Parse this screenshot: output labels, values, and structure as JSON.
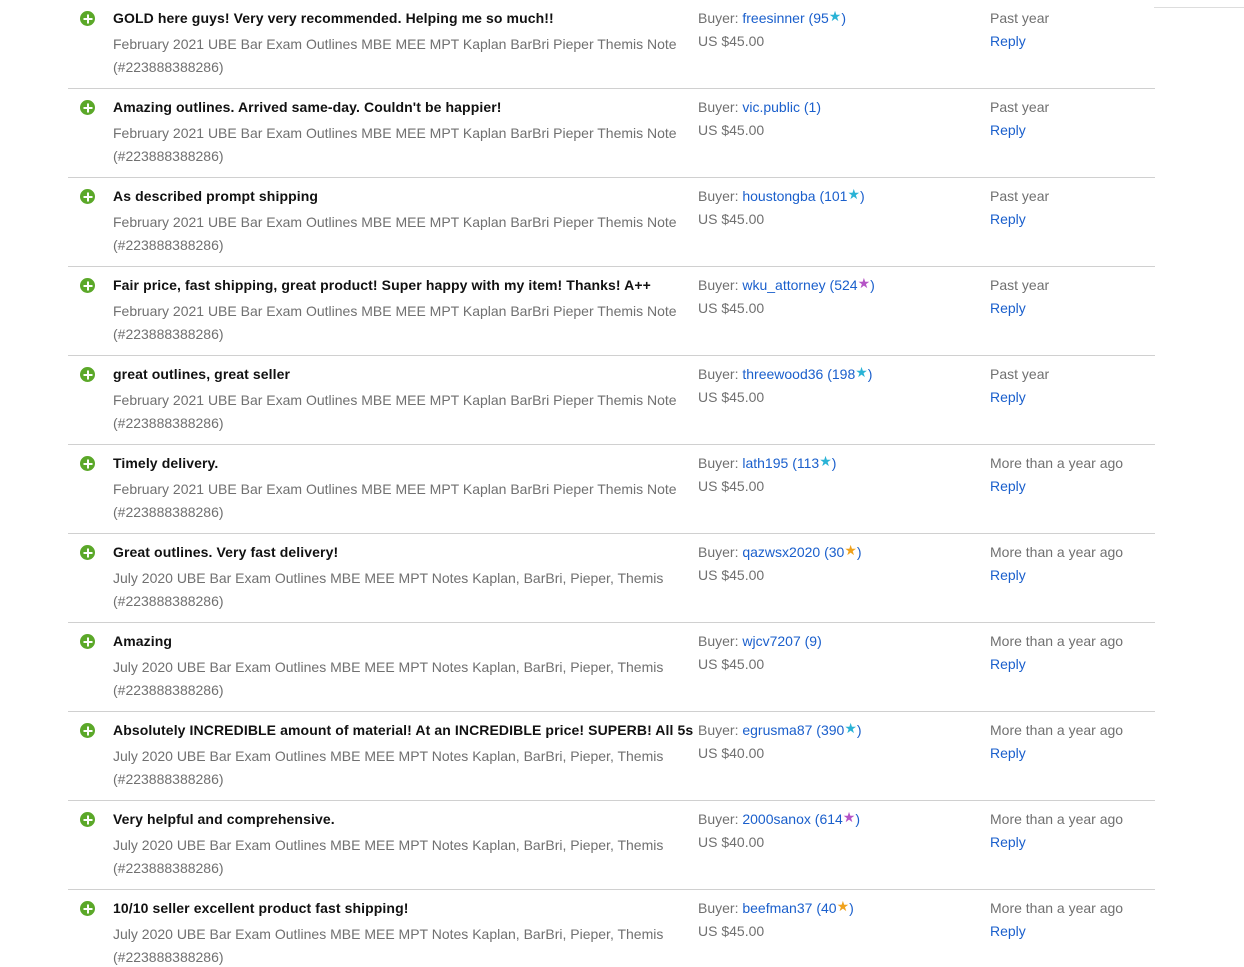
{
  "labels": {
    "buyer_prefix": "Buyer:",
    "reply": "Reply",
    "star_glyph": "★"
  },
  "star_colors": {
    "teal": "#2ab3d6",
    "purple": "#b554c6",
    "yellow": "#f0a21c"
  },
  "feedback": [
    {
      "comment": "GOLD here guys! Very very recommended. Helping me so much!!",
      "item": "February 2021 UBE Bar Exam Outlines MBE MEE MPT Kaplan BarBri Pieper Themis Note (#223888388286)",
      "buyer": "freesinner",
      "score": "95",
      "star": "teal",
      "price": "US $45.00",
      "when": "Past year"
    },
    {
      "comment": "Amazing outlines. Arrived same-day. Couldn't be happier!",
      "item": "February 2021 UBE Bar Exam Outlines MBE MEE MPT Kaplan BarBri Pieper Themis Note (#223888388286)",
      "buyer": "vic.public",
      "score": "1",
      "star": "",
      "price": "US $45.00",
      "when": "Past year"
    },
    {
      "comment": "As described prompt shipping",
      "item": "February 2021 UBE Bar Exam Outlines MBE MEE MPT Kaplan BarBri Pieper Themis Note (#223888388286)",
      "buyer": "houstongba",
      "score": "101",
      "star": "teal",
      "price": "US $45.00",
      "when": "Past year"
    },
    {
      "comment": "Fair price, fast shipping, great product! Super happy with my item! Thanks! A++",
      "item": "February 2021 UBE Bar Exam Outlines MBE MEE MPT Kaplan BarBri Pieper Themis Note (#223888388286)",
      "buyer": "wku_attorney",
      "score": "524",
      "star": "purple",
      "price": "US $45.00",
      "when": "Past year"
    },
    {
      "comment": "great outlines, great seller",
      "item": "February 2021 UBE Bar Exam Outlines MBE MEE MPT Kaplan BarBri Pieper Themis Note (#223888388286)",
      "buyer": "threewood36",
      "score": "198",
      "star": "teal",
      "price": "US $45.00",
      "when": "Past year"
    },
    {
      "comment": "Timely delivery.",
      "item": "February 2021 UBE Bar Exam Outlines MBE MEE MPT Kaplan BarBri Pieper Themis Note (#223888388286)",
      "buyer": "lath195",
      "score": "113",
      "star": "teal",
      "price": "US $45.00",
      "when": "More than a year ago"
    },
    {
      "comment": "Great outlines. Very fast delivery!",
      "item": "July 2020 UBE Bar Exam Outlines MBE MEE MPT Notes Kaplan, BarBri, Pieper, Themis (#223888388286)",
      "buyer": "qazwsx2020",
      "score": "30",
      "star": "yellow",
      "price": "US $45.00",
      "when": "More than a year ago"
    },
    {
      "comment": "Amazing",
      "item": "July 2020 UBE Bar Exam Outlines MBE MEE MPT Notes Kaplan, BarBri, Pieper, Themis (#223888388286)",
      "buyer": "wjcv7207",
      "score": "9",
      "star": "",
      "price": "US $45.00",
      "when": "More than a year ago"
    },
    {
      "comment": "Absolutely INCREDIBLE amount of material! At an INCREDIBLE price! SUPERB! All 5s",
      "item": "July 2020 UBE Bar Exam Outlines MBE MEE MPT Notes Kaplan, BarBri, Pieper, Themis (#223888388286)",
      "buyer": "egrusma87",
      "score": "390",
      "star": "teal",
      "price": "US $40.00",
      "when": "More than a year ago"
    },
    {
      "comment": "Very helpful and comprehensive.",
      "item": "July 2020 UBE Bar Exam Outlines MBE MEE MPT Notes Kaplan, BarBri, Pieper, Themis (#223888388286)",
      "buyer": "2000sanox",
      "score": "614",
      "star": "purple",
      "price": "US $40.00",
      "when": "More than a year ago"
    },
    {
      "comment": "10/10 seller excellent product fast shipping!",
      "item": "July 2020 UBE Bar Exam Outlines MBE MEE MPT Notes Kaplan, BarBri, Pieper, Themis (#223888388286)",
      "buyer": "beefman37",
      "score": "40",
      "star": "yellow",
      "price": "US $45.00",
      "when": "More than a year ago"
    }
  ]
}
